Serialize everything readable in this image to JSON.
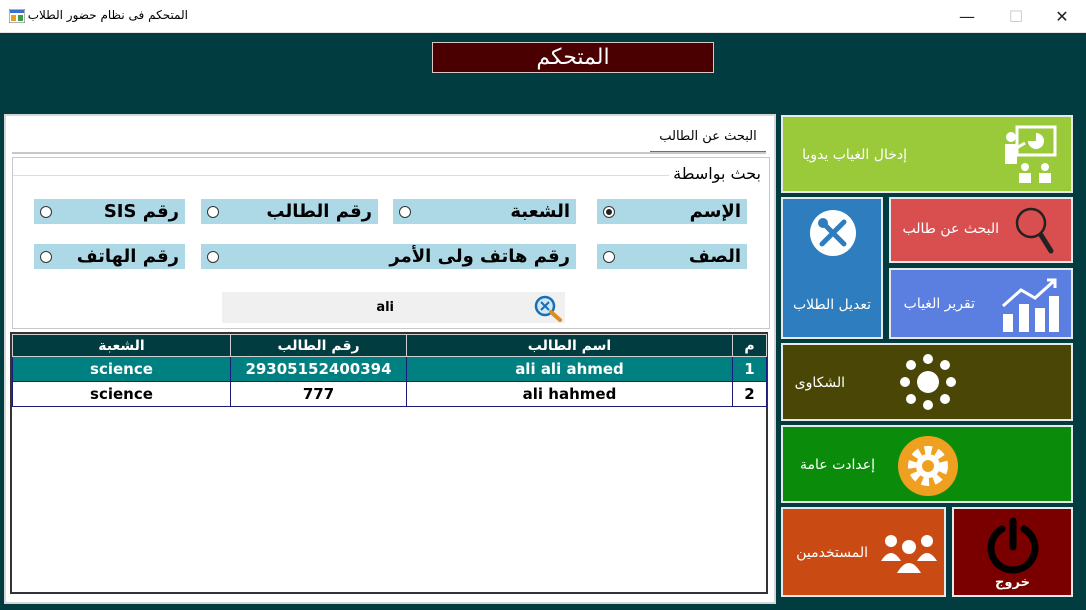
{
  "window": {
    "title": "المتحكم فى نظام حضور الطلاب",
    "min_glyph": "—",
    "max_glyph": "☐",
    "close_glyph": "✕"
  },
  "header": {
    "title": "المتحكم"
  },
  "tab": {
    "label": "البحث عن الطالب"
  },
  "search_group": {
    "title": "بحث بواسطة",
    "options": [
      {
        "label": "الإسم",
        "checked": true
      },
      {
        "label": "الشعبة",
        "checked": false
      },
      {
        "label": "رقم الطالب",
        "checked": false
      },
      {
        "label": "رقم SIS",
        "checked": false
      },
      {
        "label": "الصف",
        "checked": false
      },
      {
        "label": "رقم هاتف ولى الأمر",
        "checked": false
      },
      {
        "label": "رقم الهاتف",
        "checked": false
      }
    ]
  },
  "search": {
    "value": "ali"
  },
  "table": {
    "headers": {
      "section": "الشعبة",
      "student_no": "رقم الطالب",
      "name": "اسم الطالب",
      "index": "م"
    },
    "rows": [
      {
        "section": "science",
        "student_no": "29305152400394",
        "name": "ali ali ahmed",
        "index": "1"
      },
      {
        "section": "science",
        "student_no": "777",
        "name": "ali hahmed",
        "index": "2"
      }
    ]
  },
  "tiles": {
    "manual_absence": "إدخال الغياب يدويا",
    "search_student": "البحث عن طالب",
    "edit_students": "تعديل الطلاب",
    "absence_report": "تقرير الغياب",
    "complaints": "الشكاوى",
    "general_settings": "إعدادت عامة",
    "users": "المستخدمين",
    "exit": "خروج"
  },
  "colors": {
    "background": "#003c40",
    "manual_absence": "#9ac93a",
    "search_student": "#d94f4f",
    "edit_students": "#2e7dbf",
    "absence_report": "#5b7fe0",
    "complaints": "#4a4706",
    "general_settings": "#0a8c0a",
    "users": "#c94a12",
    "exit": "#7a0000"
  }
}
